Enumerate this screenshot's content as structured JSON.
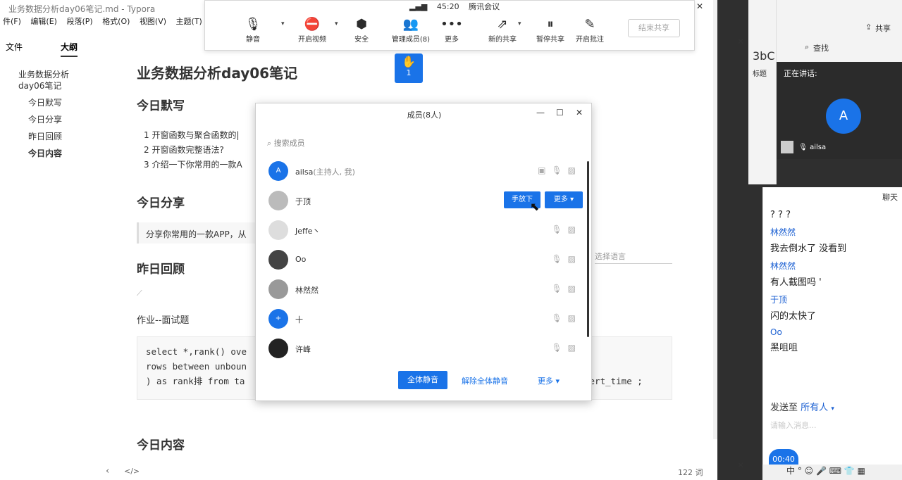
{
  "typora": {
    "title": "业务数据分析day06笔记.md - Typora",
    "menu": [
      "件(F)",
      "编辑(E)",
      "段落(P)",
      "格式(O)",
      "视图(V)",
      "主题(T)",
      "帮"
    ],
    "tabs": {
      "files": "文件",
      "outline": "大纲"
    },
    "outline": [
      "业务数据分析day06笔记",
      "今日默写",
      "今日分享",
      "昨日回顾",
      "今日内容"
    ],
    "word_count": "122 词",
    "doc": {
      "h1": "业务数据分析day06笔记",
      "s1": "今日默写",
      "items": [
        "1  开窗函数与聚合函数的|",
        "2  开窗函数完整语法?",
        "3  介绍一下你常用的一款A"
      ],
      "s2": "今日分享",
      "quote": "分享你常用的一款APP，从",
      "s3": "昨日回顾",
      "lang_placeholder": "选择语言",
      "para": "作业--面试题",
      "code": [
        "select *,rank() ove",
        "rows between unboun",
        ") as rank排 from ta"
      ],
      "code_tail": "sert_time ;",
      "s4": "今日内容"
    }
  },
  "meeting": {
    "signal_time": "45:20",
    "app_name": "腾讯会议",
    "buttons": [
      "静音",
      "开启视频",
      "安全",
      "管理成员(8)",
      "更多",
      "新的共享",
      "暂停共享",
      "开启批注"
    ],
    "end_share": "结束共享",
    "hand_count": "1"
  },
  "members": {
    "title": "成员(8人)",
    "search_placeholder": "搜索成员",
    "list": [
      {
        "initial": "A",
        "name": "ailsa",
        "tag": "(主持人, 我)"
      },
      {
        "initial": "",
        "name": "于顶",
        "tag": ""
      },
      {
        "initial": "",
        "name": "Jeffe丶",
        "tag": ""
      },
      {
        "initial": "",
        "name": "Oo",
        "tag": ""
      },
      {
        "initial": "",
        "name": "林然然",
        "tag": ""
      },
      {
        "initial": "+",
        "name": "十",
        "tag": ""
      },
      {
        "initial": "",
        "name": "许峰",
        "tag": ""
      }
    ],
    "hand_down": "手放下",
    "more": "更多",
    "mute_all": "全体静音",
    "unmute_all": "解除全体静音",
    "footer_more": "更多"
  },
  "word": {
    "share": "共享",
    "find": "查找",
    "style_sample": "3bC",
    "style_label": "标题"
  },
  "speaker": {
    "label": "正在讲话:",
    "initial": "A",
    "name": "ailsa"
  },
  "chat": {
    "header": "聊天",
    "messages": [
      {
        "from": "",
        "text": "? ? ?"
      },
      {
        "from": "林然然",
        "text": "我去倒水了 没看到"
      },
      {
        "from": "林然然",
        "text": "有人截图吗 '"
      },
      {
        "from": "于顶",
        "text": "闪的太快了"
      },
      {
        "from": "Oo",
        "text": "黑咀咀"
      }
    ],
    "send_to_label": "发送至",
    "send_to_value": "所有人",
    "input_placeholder": "请输入消息...",
    "timer": "00:40",
    "taskbar": "中 ° ☺ 🎤 ⌨ 👕 ▦"
  }
}
